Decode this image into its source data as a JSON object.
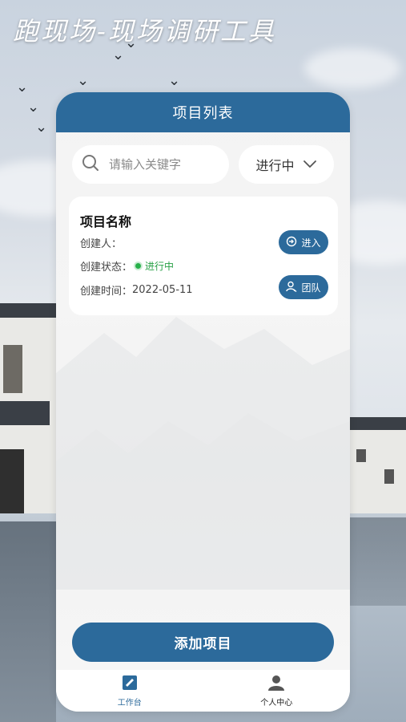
{
  "app": {
    "title": "跑现场-现场调研工具"
  },
  "header": {
    "title": "项目列表"
  },
  "search": {
    "placeholder": "请输入关键字",
    "value": ""
  },
  "filter": {
    "selected": "进行中"
  },
  "projects": [
    {
      "name": "项目名称",
      "creator_label": "创建人：",
      "creator": "",
      "status_label": "创建状态：",
      "status": "进行中",
      "created_label": "创建时间：",
      "created": "2022-05-11",
      "enter_label": "进入",
      "team_label": "团队"
    }
  ],
  "actions": {
    "add_label": "添加项目"
  },
  "tabs": [
    {
      "label": "工作台",
      "icon": "workbench-icon",
      "active": true
    },
    {
      "label": "个人中心",
      "icon": "user-icon",
      "active": false
    }
  ],
  "colors": {
    "primary": "#2c6a9b",
    "status_green": "#27b04a"
  }
}
